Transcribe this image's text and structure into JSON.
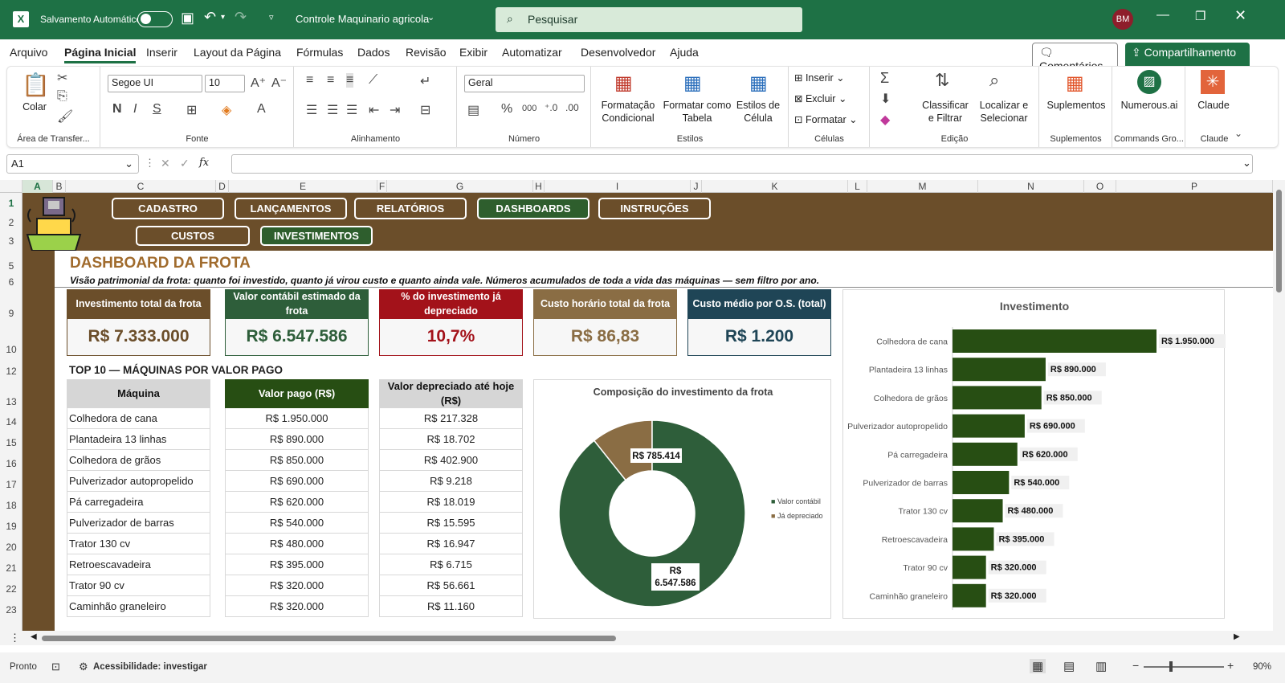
{
  "titlebar": {
    "autosave_label": "Salvamento Automático",
    "doc_title": "Controle Maquinario agricola",
    "search_placeholder": "Pesquisar",
    "user_initials": "BM"
  },
  "menu": {
    "items": [
      "Arquivo",
      "Página Inicial",
      "Inserir",
      "Layout da Página",
      "Fórmulas",
      "Dados",
      "Revisão",
      "Exibir",
      "Automatizar",
      "Desenvolvedor",
      "Ajuda"
    ],
    "comments": "Comentários",
    "share": "Compartilhamento"
  },
  "ribbon": {
    "paste": "Colar",
    "clipboard": "Área de Transfer...",
    "font_name": "Segoe UI",
    "font_size": "10",
    "font": "Fonte",
    "align": "Alinhamento",
    "number_format": "Geral",
    "number": "Número",
    "cond_fmt": "Formatação\nCondicional",
    "fmt_table": "Formatar como\nTabela",
    "cell_styles": "Estilos de\nCélula",
    "styles": "Estilos",
    "insert": "Inserir",
    "delete": "Excluir",
    "format": "Formatar",
    "cells": "Células",
    "sort": "Classificar\ne Filtrar",
    "find": "Localizar e\nSelecionar",
    "editing": "Edição",
    "addins": "Suplementos",
    "addins_grp": "Suplementos",
    "numerous": "Numerous.ai",
    "numerous_grp": "Commands Gro...",
    "claude": "Claude",
    "claude_grp": "Claude"
  },
  "formula": {
    "cell_ref": "A1",
    "fx": "fx"
  },
  "columns": [
    "A",
    "B",
    "C",
    "D",
    "E",
    "F",
    "G",
    "H",
    "I",
    "J",
    "K",
    "L",
    "M",
    "N",
    "O",
    "P"
  ],
  "rows": [
    "1",
    "2",
    "3",
    "5",
    "6",
    "9",
    "10",
    "12",
    "13",
    "14",
    "15",
    "16",
    "17",
    "18",
    "19",
    "20",
    "21",
    "22",
    "23"
  ],
  "nav": {
    "row1": [
      "CADASTRO",
      "LANÇAMENTOS",
      "RELATÓRIOS",
      "DASHBOARDS",
      "INSTRUÇÕES"
    ],
    "row2": [
      "CUSTOS",
      "INVESTIMENTOS"
    ]
  },
  "dashboard": {
    "title": "DASHBOARD DA FROTA",
    "subtitle": "Visão patrimonial da frota: quanto foi investido, quanto já virou custo e quanto ainda vale. Números acumulados de toda a vida das máquinas — sem filtro por ano."
  },
  "kpis": [
    {
      "label": "Investimento total da frota",
      "value": "R$ 7.333.000",
      "head": "#6b4e2a",
      "fg": "#6b4e2a"
    },
    {
      "label": "Valor contábil estimado da frota",
      "value": "R$ 6.547.586",
      "head": "#2e5e3a",
      "fg": "#2e5e3a"
    },
    {
      "label": "% do investimento já depreciado",
      "value": "10,7%",
      "head": "#a3121a",
      "fg": "#a3121a"
    },
    {
      "label": "Custo horário total da frota",
      "value": "R$ 86,83",
      "head": "#8a6d44",
      "fg": "#8a6d44"
    },
    {
      "label": "Custo médio por O.S. (total)",
      "value": "R$ 1.200",
      "head": "#1f4556",
      "fg": "#1f4556"
    }
  ],
  "table": {
    "title": "TOP 10 — MÁQUINAS POR VALOR PAGO",
    "headers": [
      "Máquina",
      "Valor pago (R$)",
      "Valor depreciado até hoje (R$)"
    ],
    "rows": [
      [
        "Colhedora de cana",
        "R$ 1.950.000",
        "R$ 217.328"
      ],
      [
        "Plantadeira 13 linhas",
        "R$ 890.000",
        "R$ 18.702"
      ],
      [
        "Colhedora de grãos",
        "R$ 850.000",
        "R$ 402.900"
      ],
      [
        "Pulverizador autopropelido",
        "R$ 690.000",
        "R$ 9.218"
      ],
      [
        "Pá carregadeira",
        "R$ 620.000",
        "R$ 18.019"
      ],
      [
        "Pulverizador de barras",
        "R$ 540.000",
        "R$ 15.595"
      ],
      [
        "Trator 130 cv",
        "R$ 480.000",
        "R$ 16.947"
      ],
      [
        "Retroescavadeira",
        "R$ 395.000",
        "R$ 6.715"
      ],
      [
        "Trator 90 cv",
        "R$ 320.000",
        "R$ 56.661"
      ],
      [
        "Caminhão graneleiro",
        "R$ 320.000",
        "R$ 11.160"
      ]
    ]
  },
  "chart_data": [
    {
      "type": "pie",
      "title": "Composição do investimento da frota",
      "categories": [
        "Valor contábil",
        "Já depreciado"
      ],
      "values": [
        6547586,
        785414
      ],
      "data_labels": [
        "R$ 6.547.586",
        "R$ 785.414"
      ],
      "colors": [
        "#2e5e3a",
        "#8a6d44"
      ],
      "legend": "right",
      "donut": true
    },
    {
      "type": "bar",
      "orientation": "horizontal",
      "title": "Investimento",
      "categories": [
        "Colhedora de cana",
        "Plantadeira 13 linhas",
        "Colhedora de grãos",
        "Pulverizador autopropelido",
        "Pá carregadeira",
        "Pulverizador de barras",
        "Trator 130 cv",
        "Retroescavadeira",
        "Trator 90 cv",
        "Caminhão graneleiro"
      ],
      "values": [
        1950000,
        890000,
        850000,
        690000,
        620000,
        540000,
        480000,
        395000,
        320000,
        320000
      ],
      "data_labels": [
        "R$ 1.950.000",
        "R$ 890.000",
        "R$ 850.000",
        "R$ 690.000",
        "R$ 620.000",
        "R$ 540.000",
        "R$ 480.000",
        "R$ 395.000",
        "R$ 320.000",
        "R$ 320.000"
      ],
      "color": "#274e13"
    }
  ],
  "status": {
    "ready": "Pronto",
    "accessibility": "Acessibilidade: investigar",
    "zoom": "90%"
  }
}
